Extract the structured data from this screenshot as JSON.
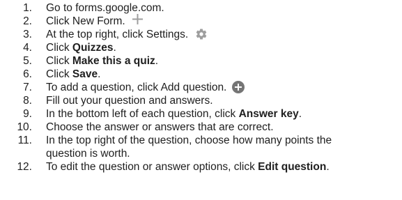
{
  "steps": [
    {
      "number": "1.",
      "text": "Go to forms.google.com."
    },
    {
      "number": "2.",
      "text": "Click New Form.",
      "icon": "plus-icon"
    },
    {
      "number": "3.",
      "text": "At the top right, click Settings.",
      "icon": "gear-icon"
    },
    {
      "number": "4.",
      "prefix": "Click ",
      "bold": "Quizzes",
      "suffix": "."
    },
    {
      "number": "5.",
      "prefix": "Click ",
      "bold": "Make this a quiz",
      "suffix": "."
    },
    {
      "number": "6.",
      "prefix": "Click ",
      "bold": "Save",
      "suffix": "."
    },
    {
      "number": "7.",
      "text": "To add a question, click Add question.",
      "icon": "add-circle-icon"
    },
    {
      "number": "8.",
      "text": "Fill out your question and answers."
    },
    {
      "number": "9.",
      "prefix": "In the bottom left of each question, click ",
      "bold": "Answer key",
      "suffix": "."
    },
    {
      "number": "10.",
      "text": "Choose the answer or answers that are correct."
    },
    {
      "number": "11.",
      "text": "In the top right of the question, choose how many points the",
      "text2": "question is worth."
    },
    {
      "number": "12.",
      "prefix": "To edit the question or answer options, click ",
      "bold": "Edit question",
      "suffix": "."
    }
  ],
  "colors": {
    "text": "#202020",
    "icon": "#9e9e9e",
    "add_icon_fill": "#757575"
  }
}
